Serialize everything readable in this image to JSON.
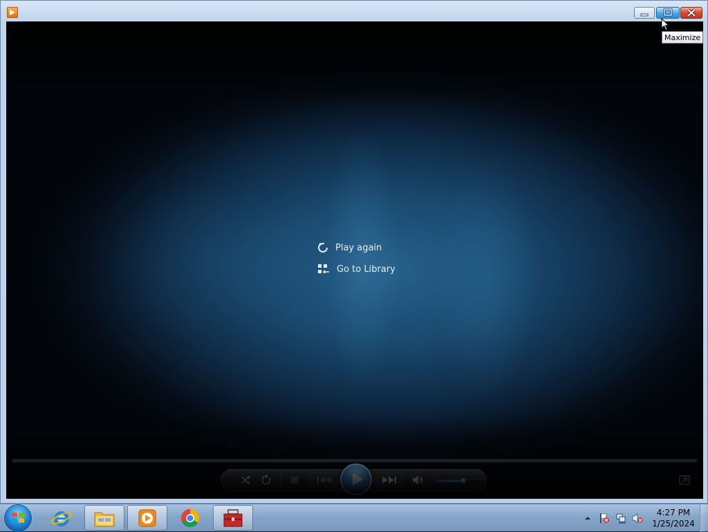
{
  "window": {
    "app_icon": "windows-media-player-icon",
    "caption_buttons": {
      "minimize": "minimize-icon",
      "maximize": "maximize-icon",
      "close": "close-icon"
    }
  },
  "tooltip": {
    "text": "Maximize"
  },
  "now_playing": {
    "play_again_label": "Play again",
    "play_again_icon": "replay-icon",
    "go_to_library_label": "Go to Library",
    "go_to_library_icon": "library-icon"
  },
  "controls": {
    "shuffle_icon": "shuffle-icon",
    "repeat_icon": "repeat-icon",
    "stop_icon": "stop-icon",
    "previous_icon": "previous-icon",
    "play_icon": "play-icon",
    "next_icon": "next-icon",
    "mute_icon": "speaker-icon",
    "volume_level": 0.6,
    "compact_mode_icon": "switch-to-compact-mode-icon"
  },
  "taskbar": {
    "start": "windows-start-icon",
    "pinned": [
      "internet-explorer-icon",
      "file-explorer-icon",
      "windows-media-player-icon",
      "chrome-icon",
      "toolbox-icon"
    ],
    "active_app": "windows-media-player-icon",
    "tray_icons": [
      "show-hidden-icons-arrow",
      "action-center-flag-icon",
      "network-icon",
      "volume-muted-icon"
    ],
    "clock_time": "4:27 PM",
    "clock_date": "1/25/2024"
  },
  "colors": {
    "video_glow": "#27618c",
    "play_button": "#3b8fd8",
    "close_button": "#d2462c",
    "maximize_button": "#47a8e3"
  }
}
